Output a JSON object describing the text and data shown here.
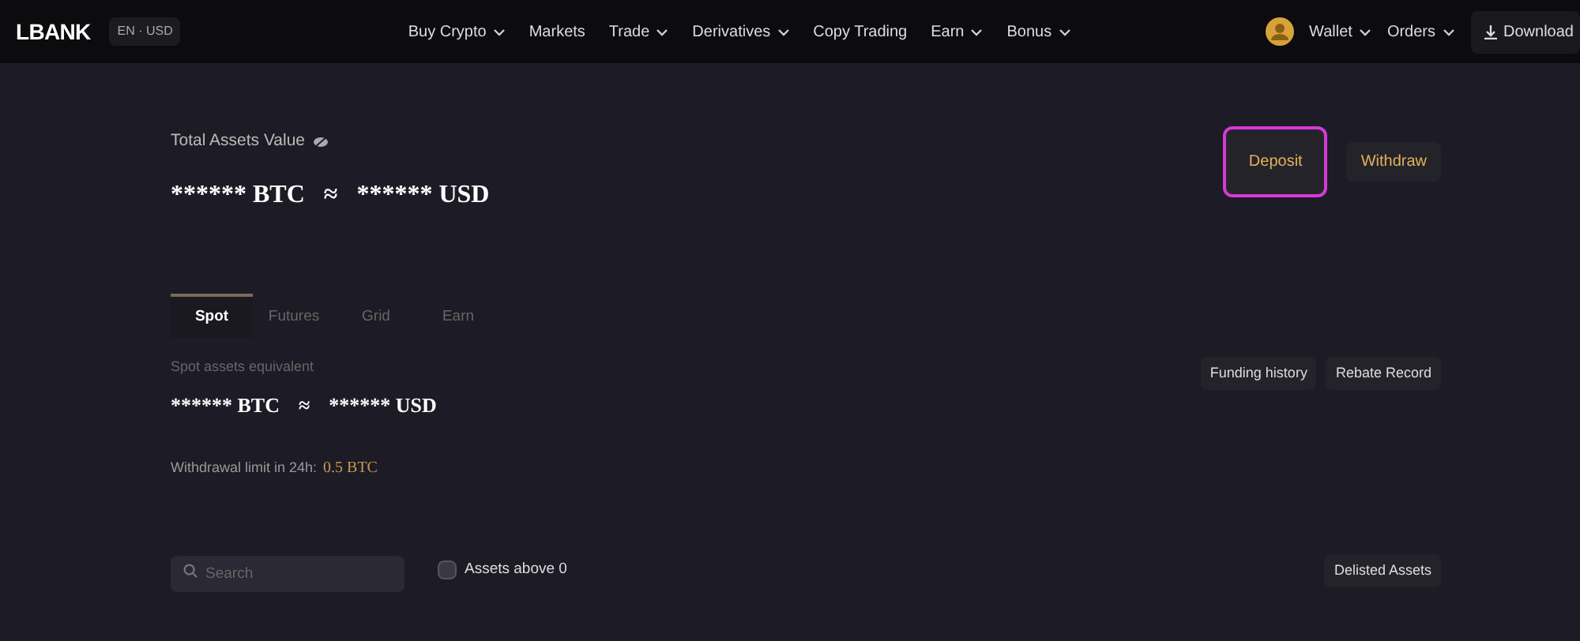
{
  "nav": {
    "logo": "LBANK",
    "locale": "EN · USD",
    "menu": [
      {
        "label": "Buy Crypto",
        "dropdown": true
      },
      {
        "label": "Markets",
        "dropdown": false
      },
      {
        "label": "Trade",
        "dropdown": true
      },
      {
        "label": "Derivatives",
        "dropdown": true
      },
      {
        "label": "Copy Trading",
        "dropdown": false
      },
      {
        "label": "Earn",
        "dropdown": true
      },
      {
        "label": "Bonus",
        "dropdown": true
      }
    ],
    "right": [
      {
        "label": "Wallet",
        "dropdown": true
      },
      {
        "label": "Orders",
        "dropdown": true
      }
    ],
    "download": "Download"
  },
  "total": {
    "label": "Total Assets Value",
    "btc": "****** BTC",
    "approx": "≈",
    "usd": "****** USD"
  },
  "actions": [
    {
      "label": "Deposit",
      "highlighted": true
    },
    {
      "label": "Withdraw",
      "highlighted": false
    }
  ],
  "tabs": [
    {
      "label": "Spot",
      "selected": true
    },
    {
      "label": "Futures",
      "selected": false
    },
    {
      "label": "Grid",
      "selected": false
    },
    {
      "label": "Earn",
      "selected": false
    }
  ],
  "spot": {
    "label": "Spot assets equivalent",
    "btc": "****** BTC",
    "approx": "≈",
    "usd": "****** USD",
    "limit_label": "Withdrawal limit in 24h:",
    "limit_value": "0.5 BTC"
  },
  "links": [
    "Funding history",
    "Rebate Record"
  ],
  "search": {
    "placeholder": "Search"
  },
  "filter": {
    "label": "Assets above 0",
    "checked": false
  },
  "delisted": "Delisted Assets"
}
